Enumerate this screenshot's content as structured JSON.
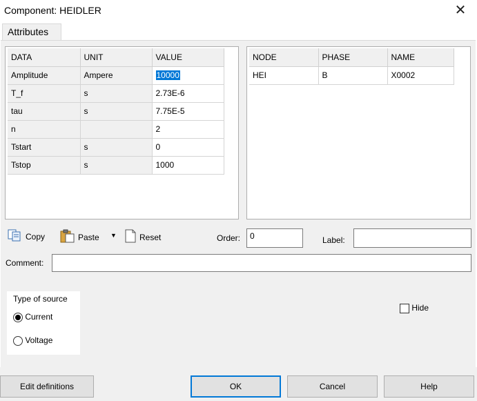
{
  "window": {
    "title": "Component: HEIDLER"
  },
  "tabs": {
    "attributes": "Attributes"
  },
  "attributes_table": {
    "headers": [
      "DATA",
      "UNIT",
      "VALUE"
    ],
    "rows": [
      [
        "Amplitude",
        "Ampere",
        "10000"
      ],
      [
        "T_f",
        "s",
        "2.73E-6"
      ],
      [
        "tau",
        "s",
        "7.75E-5"
      ],
      [
        "n",
        "",
        "2"
      ],
      [
        "Tstart",
        "s",
        "0"
      ],
      [
        "Tstop",
        "s",
        "1000"
      ]
    ]
  },
  "node_table": {
    "headers": [
      "NODE",
      "PHASE",
      "NAME"
    ],
    "rows": [
      [
        "HEI",
        "B",
        "X0002"
      ]
    ]
  },
  "toolbar": {
    "copy": "Copy",
    "paste": "Paste",
    "reset": "Reset"
  },
  "order": {
    "label": "Order:",
    "value": "0"
  },
  "label_field": {
    "label": "Label:",
    "value": ""
  },
  "comment": {
    "label": "Comment:",
    "value": ""
  },
  "source": {
    "title": "Type of source",
    "current": "Current",
    "voltage": "Voltage",
    "selected": "Current"
  },
  "hide": {
    "label": "Hide",
    "checked": false
  },
  "buttons": {
    "edit": "Edit definitions",
    "ok": "OK",
    "cancel": "Cancel",
    "help": "Help"
  },
  "colors": {
    "selection": "#0078d7",
    "panel": "#f0f0f0"
  }
}
